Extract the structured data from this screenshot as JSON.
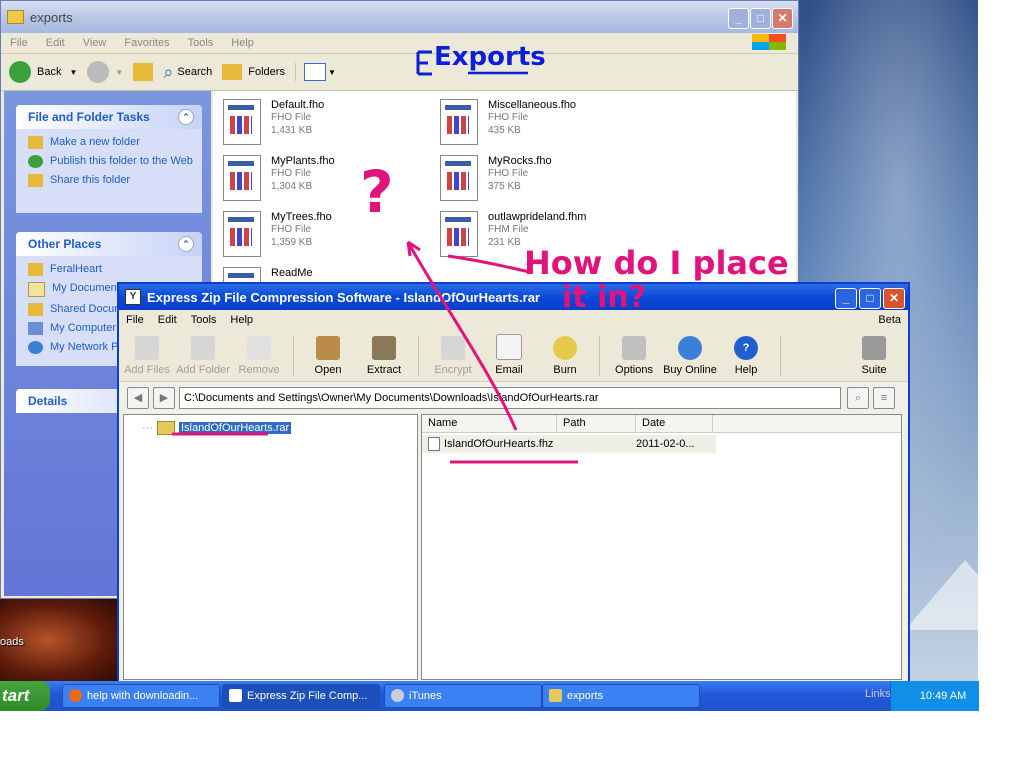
{
  "explorer": {
    "title": "exports",
    "menu": [
      "File",
      "Edit",
      "View",
      "Favorites",
      "Tools",
      "Help"
    ],
    "toolbar": {
      "back": "Back",
      "search": "Search",
      "folders": "Folders"
    },
    "tasks_header": "File and Folder Tasks",
    "tasks": [
      "Make a new folder",
      "Publish this folder to the Web",
      "Share this folder"
    ],
    "other_header": "Other Places",
    "other": [
      "FeralHeart",
      "My Documents",
      "Shared Documents",
      "My Computer",
      "My Network Places"
    ],
    "details_header": "Details",
    "files": [
      {
        "name": "Default.fho",
        "type": "FHO File",
        "size": "1,431 KB"
      },
      {
        "name": "Miscellaneous.fho",
        "type": "FHO File",
        "size": "435 KB"
      },
      {
        "name": "MyPlants.fho",
        "type": "FHO File",
        "size": "1,304 KB"
      },
      {
        "name": "MyRocks.fho",
        "type": "FHO File",
        "size": "375 KB"
      },
      {
        "name": "MyTrees.fho",
        "type": "FHO File",
        "size": "1,359 KB"
      },
      {
        "name": "outlawprideland.fhm",
        "type": "FHM File",
        "size": "231 KB"
      },
      {
        "name": "ReadMe",
        "type": "",
        "size": ""
      }
    ]
  },
  "zip": {
    "title": "Express Zip File Compression Software - IslandOfOurHearts.rar",
    "menu": [
      "File",
      "Edit",
      "Tools",
      "Help"
    ],
    "beta": "Beta",
    "tools": [
      "Add Files",
      "Add Folder",
      "Remove",
      "Open",
      "Extract",
      "Encrypt",
      "Email",
      "Burn",
      "Options",
      "Buy Online",
      "Help",
      "Suite"
    ],
    "path": "C:\\Documents and Settings\\Owner\\My Documents\\Downloads\\IslandOfOurHearts.rar",
    "tree_item": "IslandOfOurHearts.rar",
    "columns": [
      "Name",
      "Path",
      "Date"
    ],
    "row": {
      "name": "IslandOfOurHearts.fhz",
      "path": "",
      "date": "2011-02-0..."
    }
  },
  "desktop": {
    "icon_label": "oads"
  },
  "taskbar": {
    "start": "tart",
    "tasks": [
      "help with downloadin...",
      "Express Zip File Comp...",
      "iTunes",
      "exports"
    ],
    "links": "Links",
    "time": "10:49 AM"
  },
  "annotations": {
    "title": "Exports",
    "qmark": "?",
    "line1": "How do I place",
    "line2": "it in?",
    "color": "#e1147b"
  }
}
